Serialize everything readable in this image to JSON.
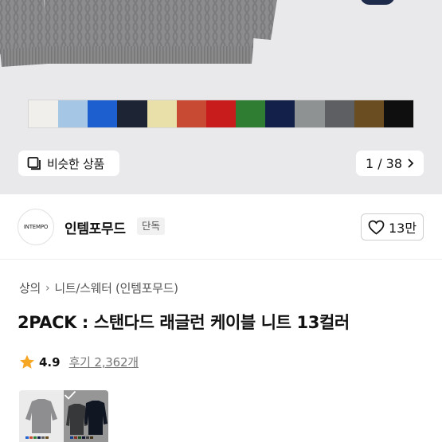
{
  "swatches": [
    "#f0efec",
    "#a6c6e6",
    "#1e5fd0",
    "#1d2433",
    "#e9dfa9",
    "#c84a33",
    "#c81c1c",
    "#2f7d32",
    "#13204a",
    "#8f9293",
    "#5d5f62",
    "#6b4d22",
    "#0f0f0f"
  ],
  "similar_button": {
    "label": "비슷한 상품",
    "icon": "similar-items-icon"
  },
  "pager": {
    "label": "1 / 38",
    "icon": "chevron-right-icon"
  },
  "brand": {
    "logo_text": "INTEMPO",
    "name": "인템포무드",
    "badge": "단독",
    "like_count": "13만",
    "like_icon": "heart-outline-icon"
  },
  "breadcrumb": [
    "상의",
    "니트/스웨터 (인템포무드)"
  ],
  "product": {
    "title": "2PACK : 스탠다드 래글런 케이블 니트 13컬러",
    "rating": "4.9",
    "reviews": "후기 2,362개",
    "rating_color": "#f5a623"
  }
}
